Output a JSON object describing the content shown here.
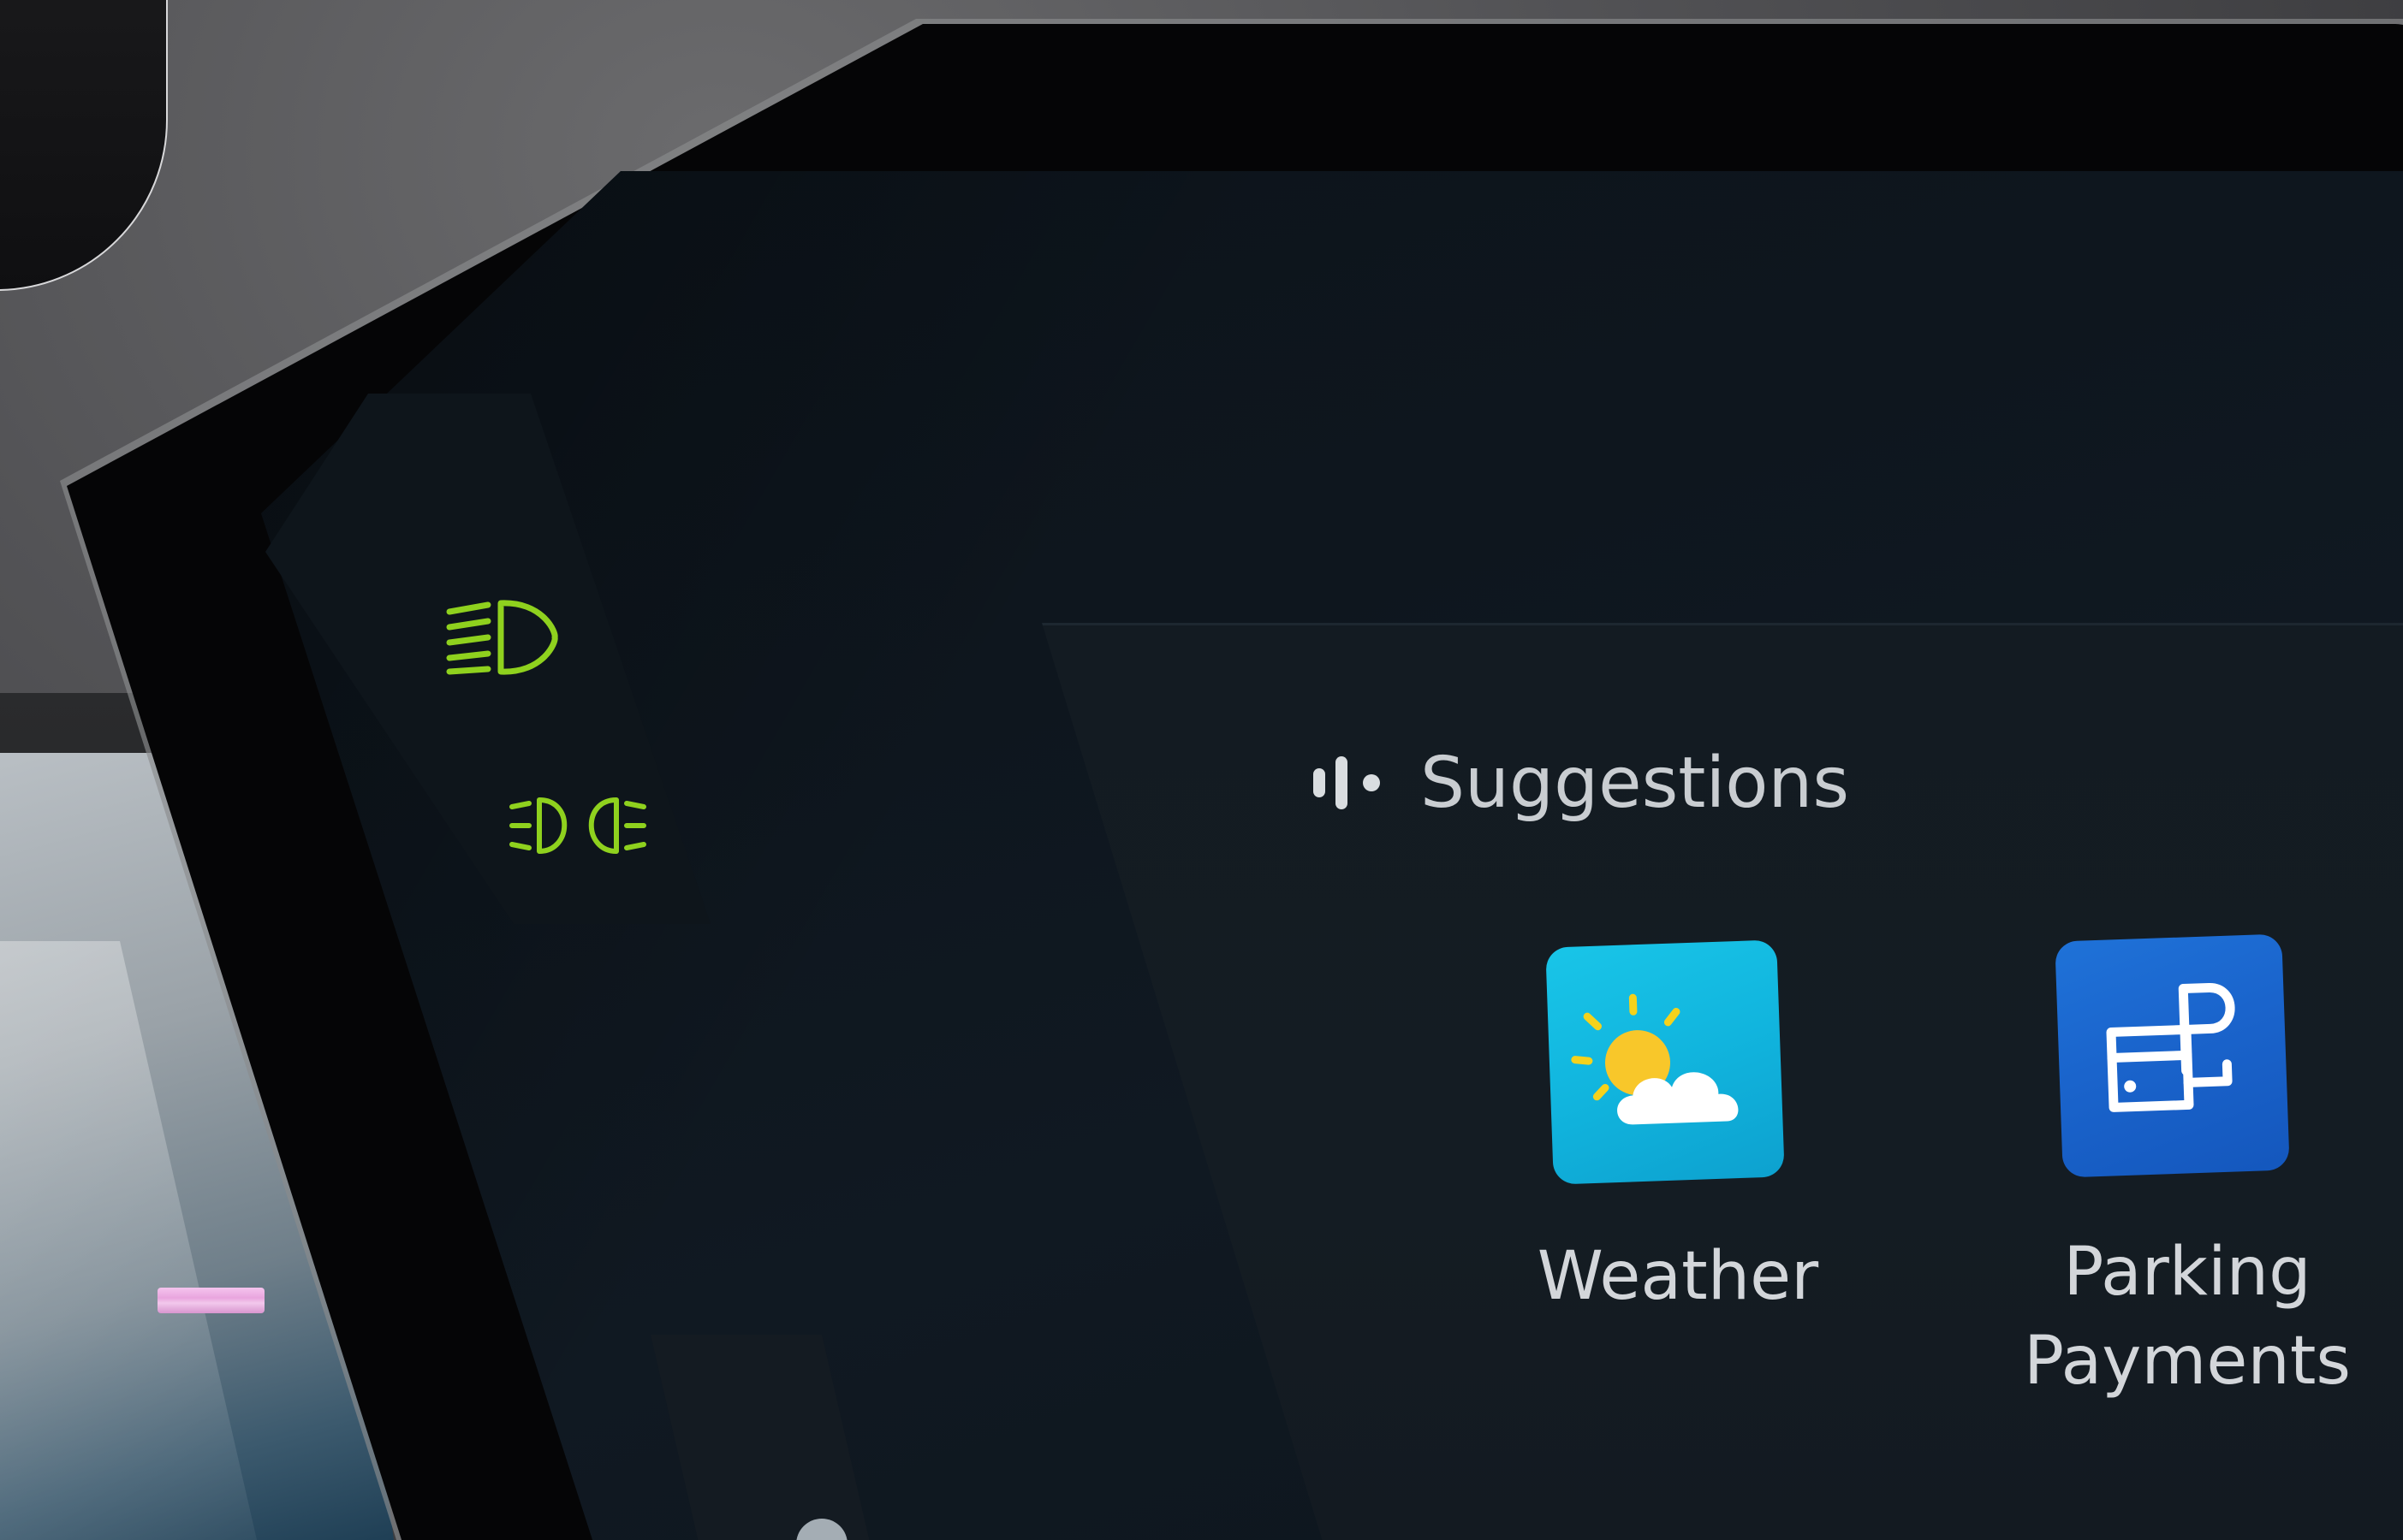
{
  "suggestions": {
    "title": "Suggestions",
    "header_icon": "voice-assistant-icon",
    "apps": [
      {
        "label": "Weather",
        "icon": "weather-sun-cloud-icon",
        "color": "#19c5e8"
      },
      {
        "label_line1": "Parking",
        "label_line2": "Payments",
        "icon": "parking-payment-card-icon",
        "color": "#1a64cc"
      }
    ]
  },
  "indicators": [
    {
      "icon": "high-beam-headlight-icon",
      "color": "#8fd11e"
    },
    {
      "icon": "fog-light-icon",
      "color": "#8fd11e"
    }
  ]
}
